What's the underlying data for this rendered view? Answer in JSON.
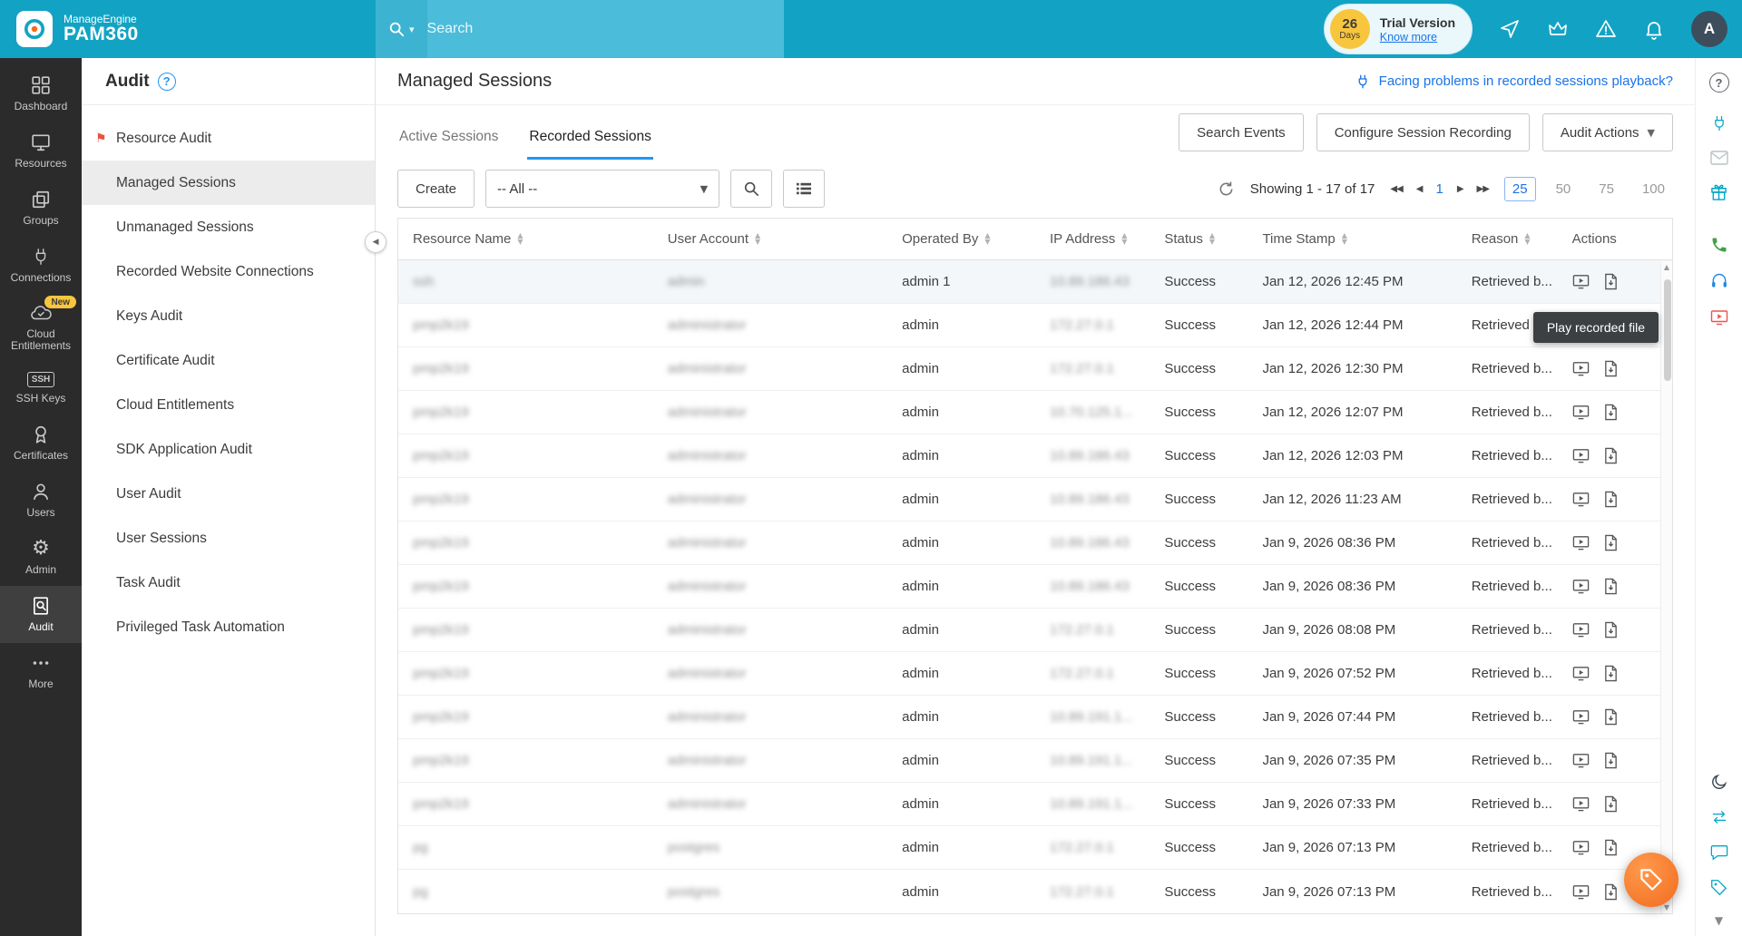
{
  "topbar": {
    "brand_line1": "ManageEngine",
    "brand_line2": "PAM360",
    "search_placeholder": "Search",
    "trial": {
      "days_number": "26",
      "days_unit": "Days",
      "title": "Trial Version",
      "link_label": "Know more"
    },
    "avatar_letter": "A"
  },
  "rail": {
    "items": [
      {
        "label": "Dashboard",
        "icon": "dashboard-icon"
      },
      {
        "label": "Resources",
        "icon": "monitor-icon"
      },
      {
        "label": "Groups",
        "icon": "groups-icon"
      },
      {
        "label": "Connections",
        "icon": "plug-icon"
      },
      {
        "label": "Cloud Entitlements",
        "icon": "cloud-check-icon",
        "badge": "New"
      },
      {
        "label": "SSH Keys",
        "icon": "ssh-box-icon",
        "icon_text": "SSH"
      },
      {
        "label": "Certificates",
        "icon": "certificate-icon"
      },
      {
        "label": "Users",
        "icon": "person-icon"
      },
      {
        "label": "Admin",
        "icon": "gear-icon"
      },
      {
        "label": "Audit",
        "icon": "audit-doc-search-icon",
        "active": true
      },
      {
        "label": "More",
        "icon": "ellipsis-icon"
      }
    ]
  },
  "nav": {
    "title": "Audit",
    "items": [
      {
        "label": "Resource Audit",
        "pinned": true
      },
      {
        "label": "Managed Sessions",
        "active": true
      },
      {
        "label": "Unmanaged Sessions"
      },
      {
        "label": "Recorded Website Connections"
      },
      {
        "label": "Keys Audit"
      },
      {
        "label": "Certificate Audit"
      },
      {
        "label": "Cloud Entitlements"
      },
      {
        "label": "SDK Application Audit"
      },
      {
        "label": "User Audit"
      },
      {
        "label": "User Sessions"
      },
      {
        "label": "Task Audit"
      },
      {
        "label": "Privileged Task Automation"
      }
    ]
  },
  "main": {
    "title": "Managed Sessions",
    "help_link": "Facing problems in recorded sessions playback?",
    "tabs": [
      {
        "label": "Active Sessions"
      },
      {
        "label": "Recorded Sessions",
        "active": true
      }
    ],
    "buttons": {
      "search_events": "Search Events",
      "configure": "Configure Session Recording",
      "audit_actions": "Audit Actions",
      "create": "Create"
    },
    "filter_value": "-- All --",
    "pagination": {
      "showing": "Showing 1 - 17 of 17",
      "page": "1",
      "sizes": [
        {
          "label": "25",
          "active": true
        },
        {
          "label": "50"
        },
        {
          "label": "75"
        },
        {
          "label": "100"
        }
      ]
    },
    "tooltip": "Play recorded file"
  },
  "table": {
    "columns": [
      {
        "label": "Resource Name"
      },
      {
        "label": "User Account"
      },
      {
        "label": "Operated By"
      },
      {
        "label": "IP Address"
      },
      {
        "label": "Status"
      },
      {
        "label": "Time Stamp"
      },
      {
        "label": "Reason"
      },
      {
        "label": "Actions",
        "nosort": true
      }
    ],
    "rows": [
      {
        "resource": "ssh",
        "user": "admin",
        "operated": "admin 1",
        "ip": "10.89.186.43",
        "status": "Success",
        "time": "Jan 12, 2026 12:45 PM",
        "reason": "Retrieved b...",
        "highlight": true
      },
      {
        "resource": "pmp2k19",
        "user": "administrator",
        "operated": "admin",
        "ip": "172.27.0.1",
        "status": "Success",
        "time": "Jan 12, 2026 12:44 PM",
        "reason": "Retrieved b..."
      },
      {
        "resource": "pmp2k19",
        "user": "administrator",
        "operated": "admin",
        "ip": "172.27.0.1",
        "status": "Success",
        "time": "Jan 12, 2026 12:30 PM",
        "reason": "Retrieved b..."
      },
      {
        "resource": "pmp2k19",
        "user": "administrator",
        "operated": "admin",
        "ip": "10.70.125.1...",
        "status": "Success",
        "time": "Jan 12, 2026 12:07 PM",
        "reason": "Retrieved b..."
      },
      {
        "resource": "pmp2k19",
        "user": "administrator",
        "operated": "admin",
        "ip": "10.89.186.43",
        "status": "Success",
        "time": "Jan 12, 2026 12:03 PM",
        "reason": "Retrieved b..."
      },
      {
        "resource": "pmp2k19",
        "user": "administrator",
        "operated": "admin",
        "ip": "10.89.186.43",
        "status": "Success",
        "time": "Jan 12, 2026 11:23 AM",
        "reason": "Retrieved b..."
      },
      {
        "resource": "pmp2k19",
        "user": "administrator",
        "operated": "admin",
        "ip": "10.89.186.43",
        "status": "Success",
        "time": "Jan 9, 2026 08:36 PM",
        "reason": "Retrieved b..."
      },
      {
        "resource": "pmp2k19",
        "user": "administrator",
        "operated": "admin",
        "ip": "10.89.186.43",
        "status": "Success",
        "time": "Jan 9, 2026 08:36 PM",
        "reason": "Retrieved b..."
      },
      {
        "resource": "pmp2k19",
        "user": "administrator",
        "operated": "admin",
        "ip": "172.27.0.1",
        "status": "Success",
        "time": "Jan 9, 2026 08:08 PM",
        "reason": "Retrieved b..."
      },
      {
        "resource": "pmp2k19",
        "user": "administrator",
        "operated": "admin",
        "ip": "172.27.0.1",
        "status": "Success",
        "time": "Jan 9, 2026 07:52 PM",
        "reason": "Retrieved b..."
      },
      {
        "resource": "pmp2k19",
        "user": "administrator",
        "operated": "admin",
        "ip": "10.89.191.1...",
        "status": "Success",
        "time": "Jan 9, 2026 07:44 PM",
        "reason": "Retrieved b..."
      },
      {
        "resource": "pmp2k19",
        "user": "administrator",
        "operated": "admin",
        "ip": "10.89.191.1...",
        "status": "Success",
        "time": "Jan 9, 2026 07:35 PM",
        "reason": "Retrieved b..."
      },
      {
        "resource": "pmp2k19",
        "user": "administrator",
        "operated": "admin",
        "ip": "10.89.191.1...",
        "status": "Success",
        "time": "Jan 9, 2026 07:33 PM",
        "reason": "Retrieved b..."
      },
      {
        "resource": "pg",
        "user": "postgres",
        "operated": "admin",
        "ip": "172.27.0.1",
        "status": "Success",
        "time": "Jan 9, 2026 07:13 PM",
        "reason": "Retrieved b..."
      },
      {
        "resource": "pg",
        "user": "postgres",
        "operated": "admin",
        "ip": "172.27.0.1",
        "status": "Success",
        "time": "Jan 9, 2026 07:13 PM",
        "reason": "Retrieved b..."
      }
    ]
  },
  "right_rail": {
    "icons": [
      "help",
      "plug",
      "mail",
      "gift",
      "phone",
      "headset",
      "screen-recording",
      "dark-mode",
      "switch",
      "chat",
      "tag",
      "chevron-down"
    ]
  },
  "colors": {
    "topbar_teal": "#12a3c4",
    "search_strip": "#4bbcd9",
    "accent_blue": "#2196f3",
    "link_blue": "#1a73e8",
    "badge_yellow": "#f8c63d",
    "fab_orange": "#f26b1d",
    "pin_red": "#e8553e"
  }
}
